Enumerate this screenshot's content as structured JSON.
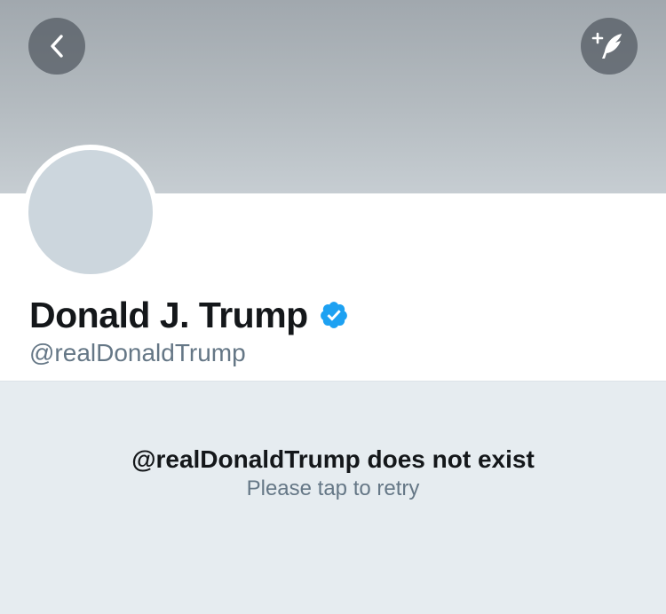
{
  "header": {
    "back_icon": "chevron-left-icon",
    "compose_icon": "compose-tweet-feather-icon",
    "banner_color": "#b4bbc0"
  },
  "profile": {
    "display_name": "Donald J. Trump",
    "handle": "@realDonaldTrump",
    "verified": true,
    "verified_badge_color": "#1da1f2",
    "avatar_placeholder_color": "#ccd6dd"
  },
  "empty_state": {
    "title": "@realDonaldTrump does not exist",
    "subtitle": "Please tap to retry",
    "background": "#e6ecf0"
  }
}
